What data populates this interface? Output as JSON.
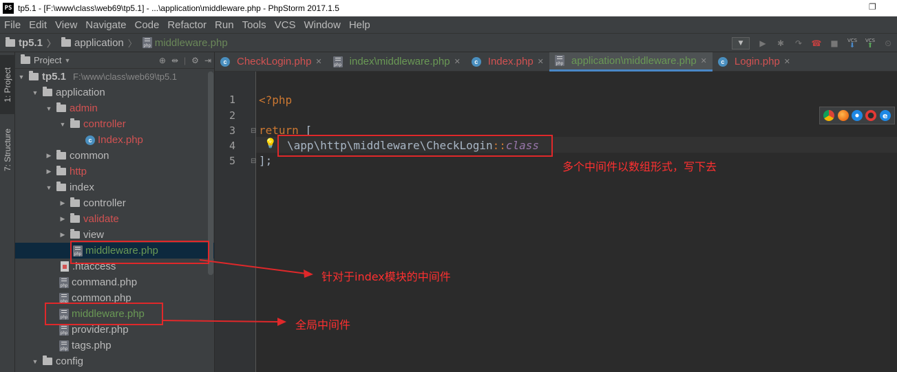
{
  "window": {
    "title": "tp5.1 - [F:\\www\\class\\web69\\tp5.1] - ...\\application\\middleware.php - PhpStorm 2017.1.5",
    "logo_text": "PS"
  },
  "menu": [
    "File",
    "Edit",
    "View",
    "Navigate",
    "Code",
    "Refactor",
    "Run",
    "Tools",
    "VCS",
    "Window",
    "Help"
  ],
  "breadcrumb": {
    "project": "tp5.1",
    "folder": "application",
    "file": "middleware.php"
  },
  "toolbar": {
    "vcs1": "VCS",
    "vcs2": "VCS"
  },
  "side_tabs": {
    "project": "1: Project",
    "structure": "7: Structure"
  },
  "project_panel": {
    "title": "Project",
    "root": {
      "name": "tp5.1",
      "path": "F:\\www\\class\\web69\\tp5.1"
    },
    "items": [
      {
        "label": "application",
        "kind": "folder",
        "open": true,
        "color": "plain"
      },
      {
        "label": "admin",
        "kind": "folder",
        "open": true,
        "color": "red"
      },
      {
        "label": "controller",
        "kind": "folder",
        "open": true,
        "color": "red"
      },
      {
        "label": "Index.php",
        "kind": "class",
        "color": "red"
      },
      {
        "label": "common",
        "kind": "folder",
        "open": false,
        "color": "plain"
      },
      {
        "label": "http",
        "kind": "folder",
        "open": false,
        "color": "red"
      },
      {
        "label": "index",
        "kind": "folder",
        "open": true,
        "color": "plain"
      },
      {
        "label": "controller",
        "kind": "folder",
        "open": false,
        "color": "plain"
      },
      {
        "label": "validate",
        "kind": "folder",
        "open": false,
        "color": "red"
      },
      {
        "label": "view",
        "kind": "folder",
        "open": false,
        "color": "plain"
      },
      {
        "label": "middleware.php",
        "kind": "php",
        "color": "green"
      },
      {
        "label": ".htaccess",
        "kind": "htaccess",
        "color": "plain"
      },
      {
        "label": "command.php",
        "kind": "php",
        "color": "plain"
      },
      {
        "label": "common.php",
        "kind": "php",
        "color": "plain"
      },
      {
        "label": "middleware.php",
        "kind": "php",
        "color": "green"
      },
      {
        "label": "provider.php",
        "kind": "php",
        "color": "plain"
      },
      {
        "label": "tags.php",
        "kind": "php",
        "color": "plain"
      },
      {
        "label": "config",
        "kind": "folder",
        "open": true,
        "color": "plain"
      }
    ]
  },
  "editor_tabs": [
    {
      "label": "CheckLogin.php",
      "kind": "class",
      "color": "red"
    },
    {
      "label": "index\\middleware.php",
      "kind": "php",
      "color": "green"
    },
    {
      "label": "Index.php",
      "kind": "class",
      "color": "red"
    },
    {
      "label": "application\\middleware.php",
      "kind": "php",
      "color": "green",
      "active": true
    },
    {
      "label": "Login.php",
      "kind": "class",
      "color": "red"
    }
  ],
  "code": {
    "line_numbers": [
      "1",
      "2",
      "3",
      "4",
      "5"
    ],
    "l1": "<?php",
    "l3_kw": "return",
    "l3_rest": " [",
    "l4_path": "\\app\\http\\middleware\\CheckLogin",
    "l4_ops": "::",
    "l4_class": "class",
    "l5": "];"
  },
  "annotations": {
    "code_note": "多个中间件以数组形式，写下去",
    "index_note": "针对于index模块的中间件",
    "global_note": "全局中间件"
  },
  "colors": {
    "annotation_red": "#e0282a",
    "keyword": "#cc7832",
    "folder_red": "#d25252",
    "file_green": "#6a9955"
  }
}
